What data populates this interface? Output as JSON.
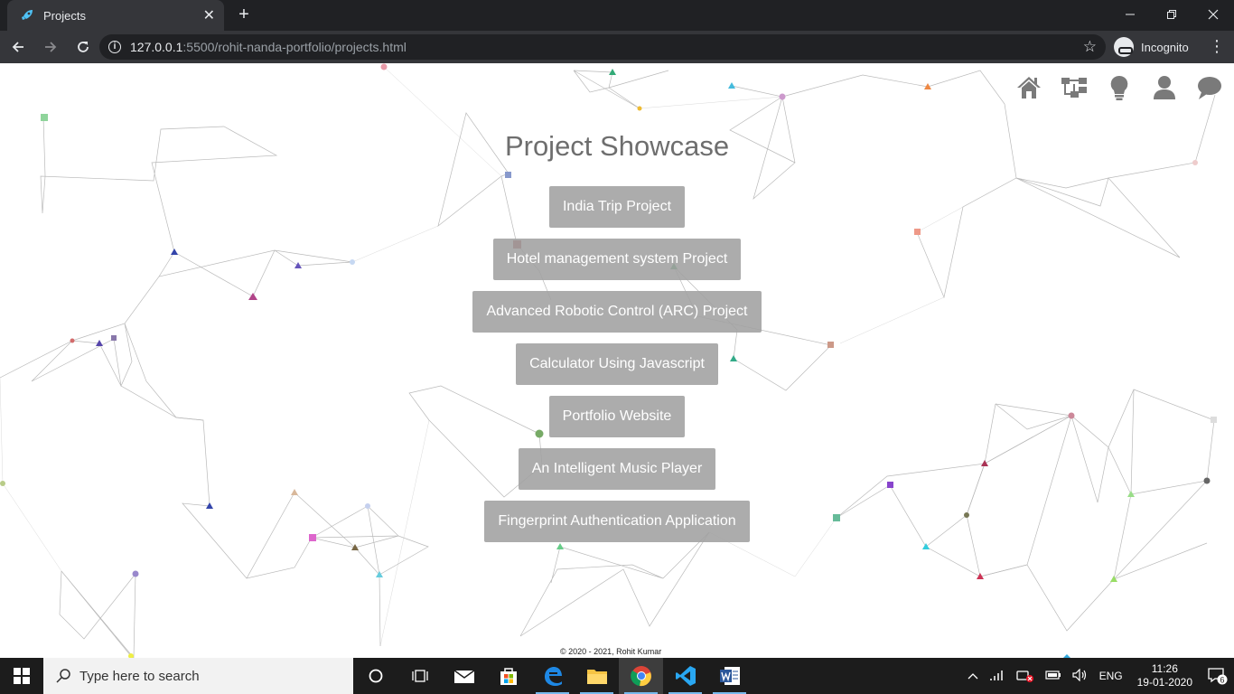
{
  "browser": {
    "tab_title": "Projects",
    "tab_close": "✕",
    "new_tab": "+",
    "url_host": "127.0.0.1",
    "url_path": ":5500/rohit-nanda-portfolio/projects.html",
    "profile_label": "Incognito"
  },
  "page": {
    "title": "Project Showcase",
    "projects": [
      "India Trip Project",
      "Hotel management system Project",
      "Advanced Robotic Control (ARC) Project",
      "Calculator Using Javascript",
      "Portfolio Website",
      "An Intelligent Music Player",
      "Fingerprint Authentication Application"
    ],
    "footer": "© 2020 - 2021, Rohit Kumar",
    "nav_icons": [
      "home-icon",
      "sitemap-icon",
      "lightbulb-icon",
      "user-icon",
      "comment-icon"
    ]
  },
  "taskbar": {
    "search_placeholder": "Type here to search",
    "language": "ENG",
    "time": "11:26",
    "date": "19-01-2020",
    "notification_count": "6"
  },
  "colors": {
    "tab_bar": "#202124",
    "toolbar": "#35363a",
    "title_text": "#6e6e6e",
    "project_button": "#a0a0a0",
    "taskbar": "#1c1c1c"
  }
}
